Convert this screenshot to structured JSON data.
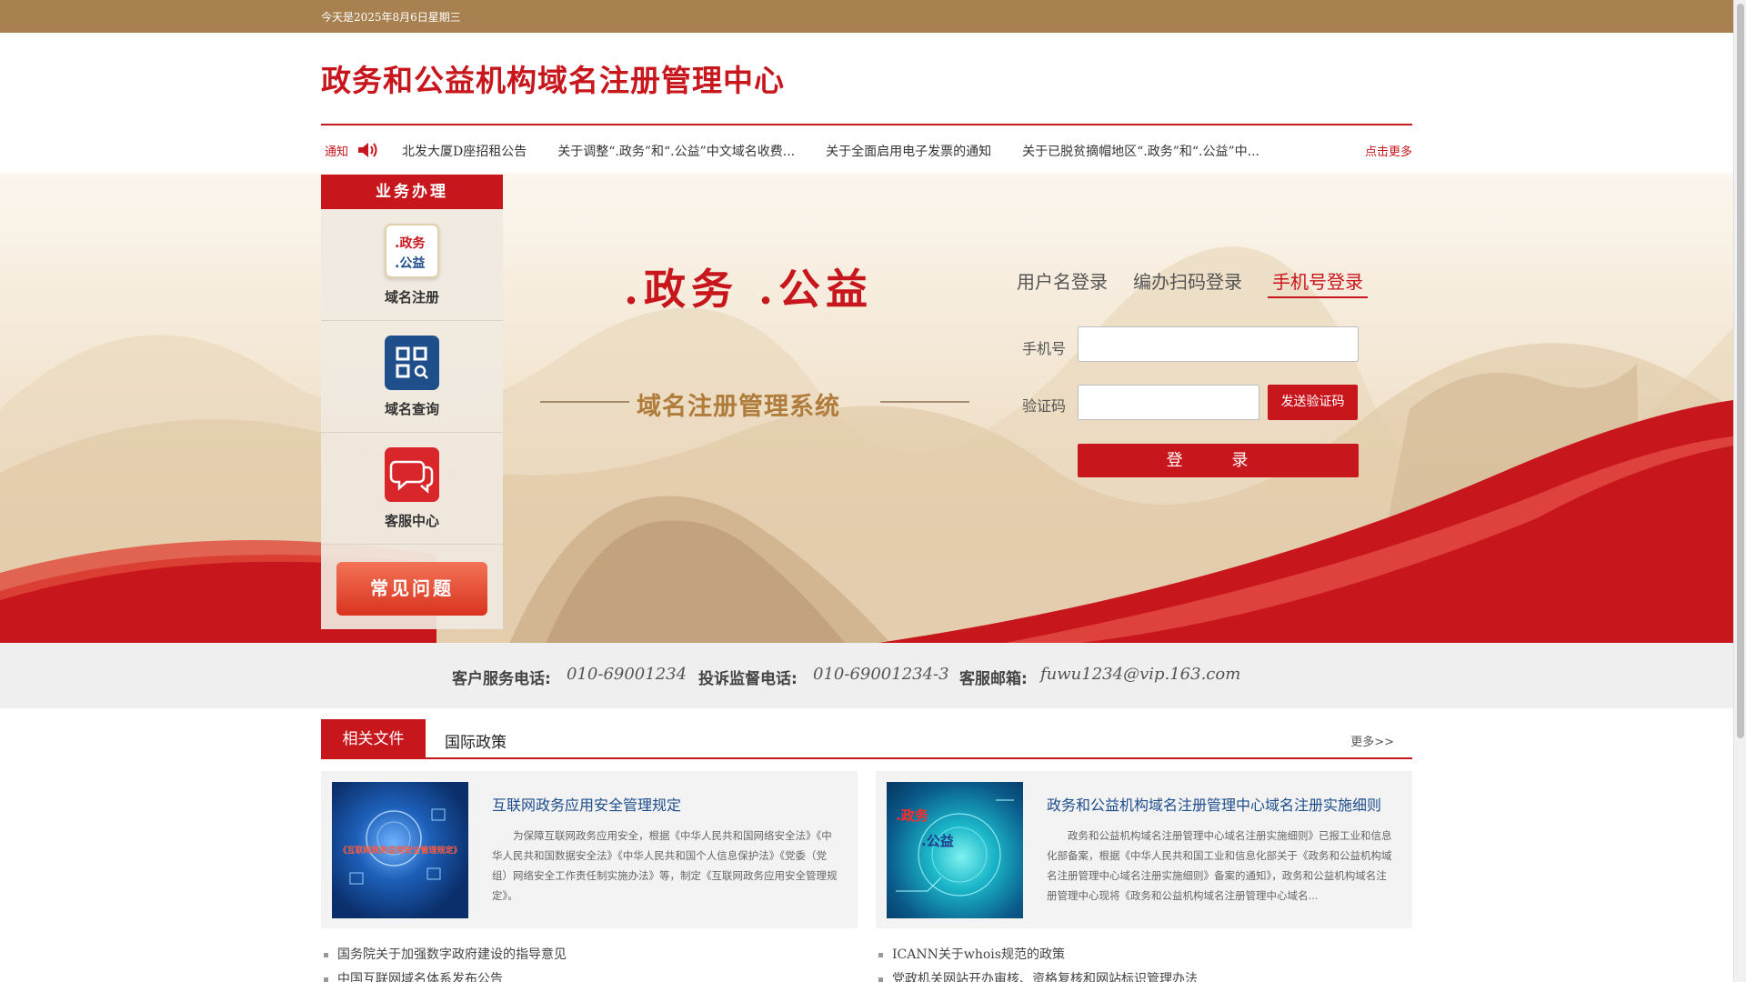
{
  "topbar": {
    "date": "今天是2025年8月6日星期三"
  },
  "header": {
    "title": "政务和公益机构域名注册管理中心"
  },
  "notice": {
    "label": "通知",
    "items": [
      "北发大厦D座招租公告",
      "关于调整“.政务”和“.公益”中文域名收费...",
      "关于全面启用电子发票的通知",
      "关于已脱贫摘帽地区“.政务”和“.公益”中..."
    ],
    "more": "点击更多"
  },
  "sidebar": {
    "title": "业务办理",
    "services": [
      {
        "label": "域名注册",
        "icon_text_1": ".政务",
        "icon_text_2": ".公益"
      },
      {
        "label": "域名查询"
      },
      {
        "label": "客服中心"
      }
    ],
    "faq": "常见问题"
  },
  "banner": {
    "logo_line1": ".政务 .公益",
    "logo_line2": "域名注册管理系统"
  },
  "login": {
    "tabs": [
      "用户名登录",
      "编办扫码登录",
      "手机号登录"
    ],
    "phone_label": "手机号",
    "code_label": "验证码",
    "phone_value": "",
    "code_value": "",
    "send_code": "发送验证码",
    "submit": "登 录"
  },
  "contact": {
    "service_label": "客户服务电话:",
    "service_value": "010-69001234",
    "complaint_label": "投诉监督电话:",
    "complaint_value": "010-69001234-3",
    "email_label": "客服邮箱:",
    "email_value": "fuwu1234@vip.163.com"
  },
  "docs": {
    "tab_active": "相关文件",
    "tab_other": "国际政策",
    "more": "更多>>",
    "cards": [
      {
        "title": "互联网政务应用安全管理规定",
        "thumb_caption": "《互联网政务应用安全管理规定》",
        "summary": "为保障互联网政务应用安全，根据《中华人民共和国网络安全法》《中华人民共和国数据安全法》《中华人民共和国个人信息保护法》《党委（党组）网络安全工作责任制实施办法》等，制定《互联网政务应用安全管理规定》。"
      },
      {
        "title": "政务和公益机构域名注册管理中心域名注册实施细则",
        "thumb_line1": ".政务",
        "thumb_line2": ".公益",
        "summary": "政务和公益机构域名注册管理中心域名注册实施细则》已报工业和信息化部备案，根据《中华人民共和国工业和信息化部关于《政务和公益机构域名注册管理中心域名注册实施细则》备案的通知》，政务和公益机构域名注册管理中心现将《政务和公益机构域名注册管理中心域名..."
      }
    ],
    "list_left": [
      "国务院关于加强数字政府建设的指导意见",
      "中国互联网域名体系发布公告"
    ],
    "list_right": [
      "ICANN关于whois规范的政策",
      "党政机关网站开办审核、资格复核和网站标识管理办法"
    ]
  },
  "colors": {
    "brand_red": "#c8161d",
    "topbar": "#a98150",
    "link_blue": "#1e4d8c"
  }
}
